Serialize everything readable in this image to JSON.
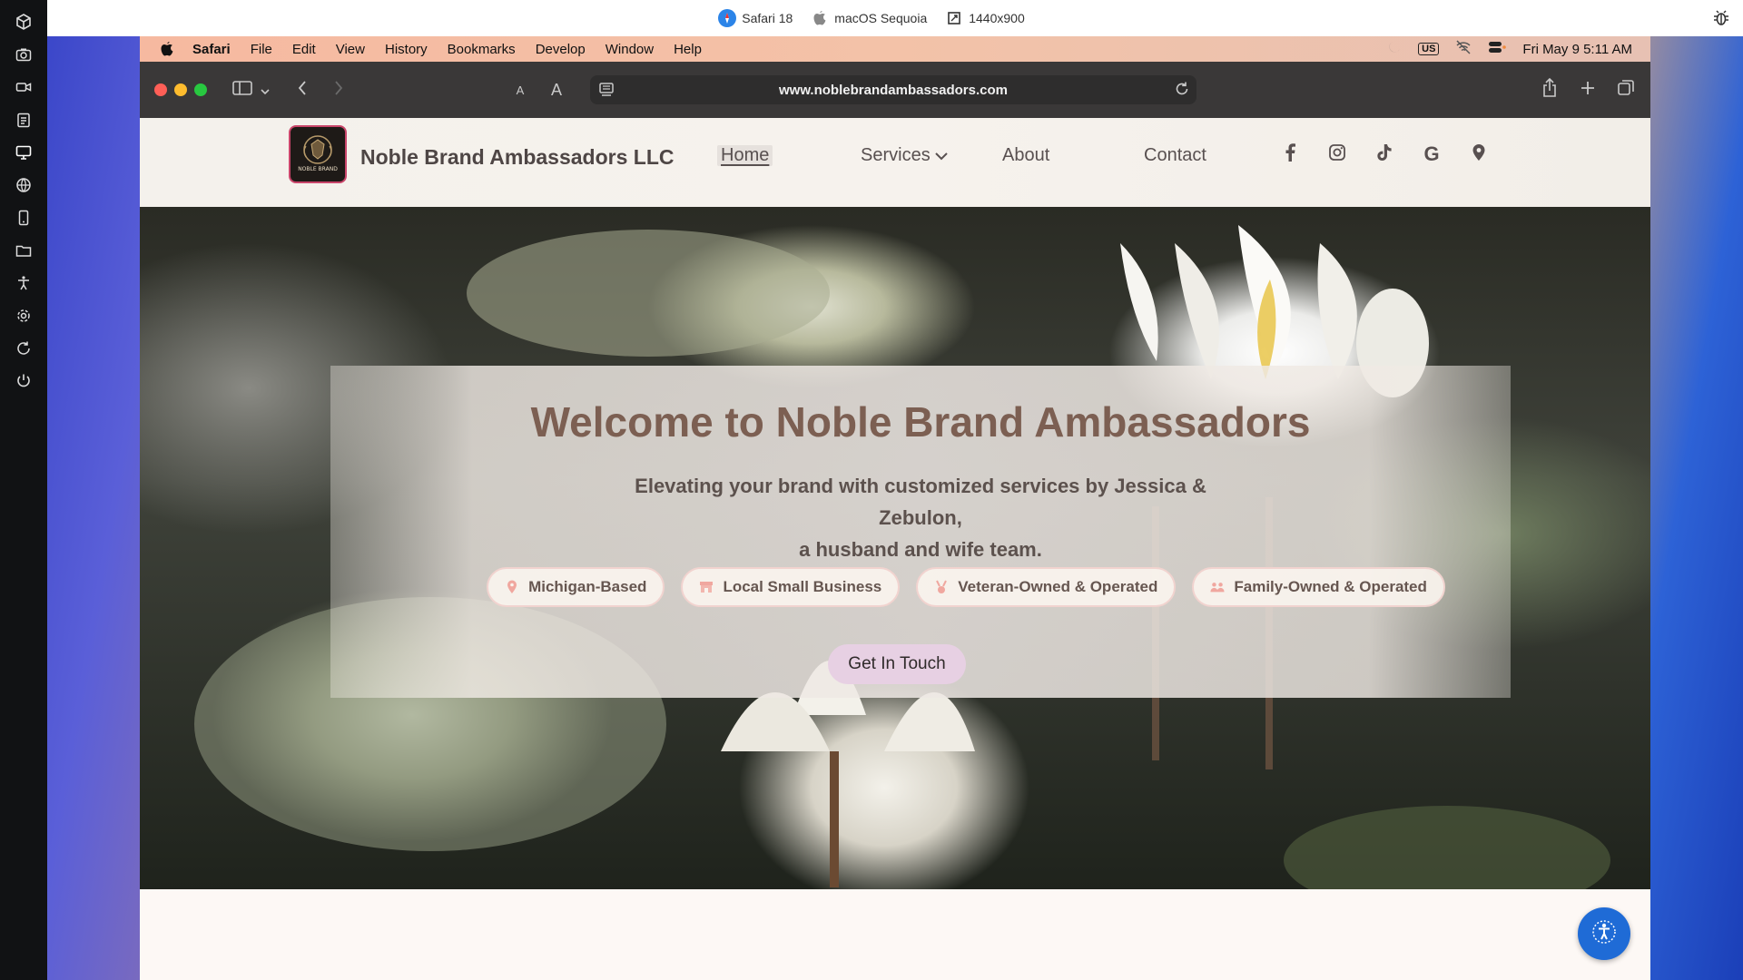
{
  "top_strip": {
    "browser": "Safari 18",
    "os": "macOS Sequoia",
    "resolution": "1440x900"
  },
  "menubar": {
    "app": "Safari",
    "items": [
      "File",
      "Edit",
      "View",
      "History",
      "Bookmarks",
      "Develop",
      "Window",
      "Help"
    ],
    "input_source": "US",
    "clock": "Fri May 9  5:11 AM"
  },
  "toolbar": {
    "url": "www.noblebrandambassadors.com",
    "text_small": "A",
    "text_large": "A"
  },
  "site": {
    "name": "Noble Brand Ambassadors LLC",
    "logo_text": "NOBLE BRAND",
    "nav": {
      "home": "Home",
      "services": "Services",
      "about": "About",
      "contact": "Contact"
    },
    "social": [
      "facebook-icon",
      "instagram-icon",
      "tiktok-icon",
      "google-icon",
      "map-pin-icon"
    ],
    "google_letter": "G"
  },
  "hero": {
    "title": "Welcome to Noble Brand Ambassadors",
    "subtitle_line1": "Elevating your brand with customized services by Jessica & Zebulon,",
    "subtitle_line2": "a husband and wife team.",
    "badges": [
      {
        "icon": "map-pin-icon",
        "label": "Michigan-Based"
      },
      {
        "icon": "store-icon",
        "label": "Local Small Business"
      },
      {
        "icon": "medal-icon",
        "label": "Veteran-Owned & Operated"
      },
      {
        "icon": "people-icon",
        "label": "Family-Owned & Operated"
      }
    ],
    "cta": "Get In Touch"
  },
  "colors": {
    "accent_pink": "#f0a79f",
    "title_brown": "#7c5f52",
    "cta_bg": "#e7d0e3",
    "fab_blue": "#1f6bd6"
  }
}
